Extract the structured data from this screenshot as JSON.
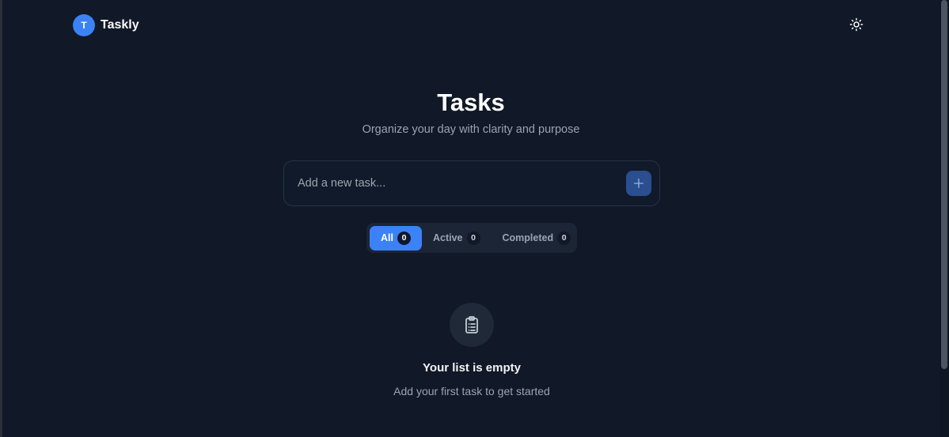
{
  "header": {
    "logo_letter": "T",
    "app_name": "Taskly",
    "theme_icon": "sun-icon"
  },
  "page": {
    "title": "Tasks",
    "subtitle": "Organize your day with clarity and purpose"
  },
  "task_form": {
    "placeholder": "Add a new task...",
    "value": "",
    "add_icon": "plus-icon"
  },
  "filters": [
    {
      "label": "All",
      "count": "0",
      "active": true
    },
    {
      "label": "Active",
      "count": "0",
      "active": false
    },
    {
      "label": "Completed",
      "count": "0",
      "active": false
    }
  ],
  "empty_state": {
    "icon": "clipboard-list-icon",
    "title": "Your list is empty",
    "subtitle": "Add your first task to get started"
  },
  "colors": {
    "background": "#111827",
    "accent": "#3b82f6",
    "muted_text": "#9aa3b5"
  }
}
